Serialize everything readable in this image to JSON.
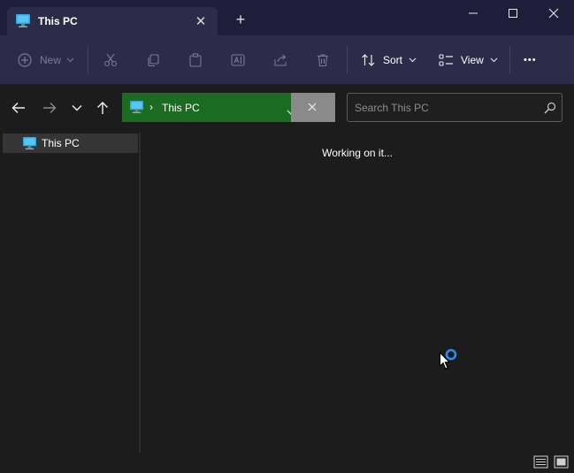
{
  "window": {
    "tab_title": "This PC",
    "tab_close_label": "✕",
    "new_tab_label": "+"
  },
  "toolbar": {
    "new_label": "New",
    "sort_label": "Sort",
    "view_label": "View",
    "more_label": "•••"
  },
  "navigation": {
    "address_text": "This PC",
    "address_separator": "›",
    "search_placeholder": "Search This PC"
  },
  "sidebar": {
    "items": [
      {
        "label": "This PC",
        "icon": "computer-icon",
        "selected": true
      }
    ]
  },
  "main": {
    "status_text": "Working on it..."
  },
  "colors": {
    "titlebar": "#1e1e3a",
    "toolbar": "#2c2c4a",
    "address_highlight": "#1b6b22",
    "accent": "#2b8de8",
    "background": "#1c1c1c"
  }
}
